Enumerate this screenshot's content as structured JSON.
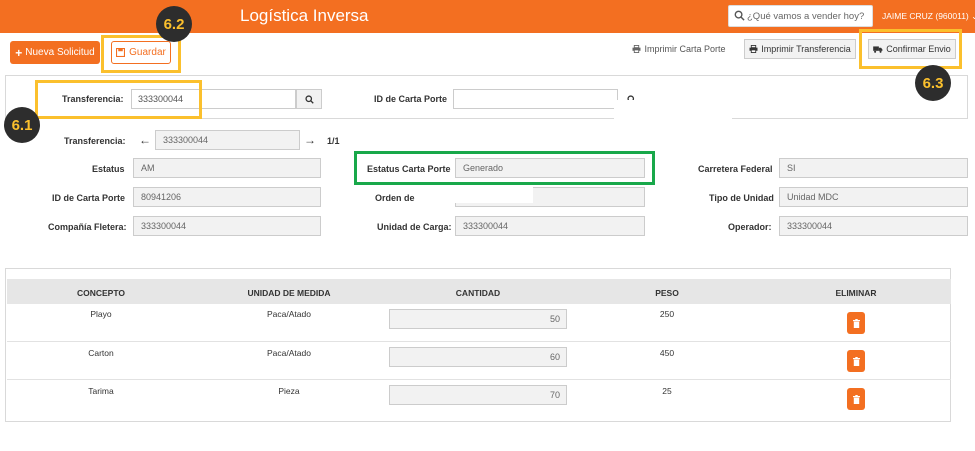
{
  "header": {
    "title": "Logística Inversa",
    "search_placeholder": "¿Qué vamos a vender hoy?",
    "user": "JAIME CRUZ (960011)",
    "user_caret": "⌄"
  },
  "toolbar": {
    "new_label": "Nueva Solicitud",
    "save_label": "Guardar",
    "print_cp_label": "Imprimir Carta Porte",
    "print_tr_label": "Imprimir Transferencia",
    "confirm_label": "Confirmar Envio"
  },
  "annotations": {
    "a61": "6.1",
    "a62": "6.2",
    "a63": "6.3"
  },
  "search_panel": {
    "transfer_label": "Transferencia:",
    "transfer_value": "333300044",
    "carta_porte_label": "ID de Carta Porte",
    "carta_porte_value": ""
  },
  "detail": {
    "transfer_label": "Transferencia:",
    "transfer_value": "333300044",
    "pager": "1/1",
    "estatus_label": "Estatus",
    "estatus_value": "AM",
    "estatus_cp_label": "Estatus Carta Porte",
    "estatus_cp_value": "Generado",
    "carretera_label": "Carretera Federal",
    "carretera_value": "SI",
    "id_cp_label": "ID de Carta Porte",
    "id_cp_value": "80941206",
    "orden_label": "Orden de",
    "orden_value": "",
    "tipo_unidad_label": "Tipo de Unidad",
    "tipo_unidad_value": "Unidad MDC",
    "compania_label": "Compañía Fletera:",
    "compania_value": "333300044",
    "unidad_carga_label": "Unidad de Carga:",
    "unidad_carga_value": "333300044",
    "operador_label": "Operador:",
    "operador_value": "333300044"
  },
  "table": {
    "headers": [
      "CONCEPTO",
      "UNIDAD DE MEDIDA",
      "CANTIDAD",
      "PESO",
      "ELIMINAR"
    ],
    "rows": [
      {
        "concepto": "Playo",
        "unidad": "Paca/Atado",
        "cantidad": "50",
        "peso": "250"
      },
      {
        "concepto": "Carton",
        "unidad": "Paca/Atado",
        "cantidad": "60",
        "peso": "450"
      },
      {
        "concepto": "Tarima",
        "unidad": "Pieza",
        "cantidad": "70",
        "peso": "25"
      }
    ]
  },
  "colors": {
    "accent": "#f36f21",
    "highlight": "#fbc02d",
    "highlight_green": "#18a84a"
  },
  "icons": {
    "search": "search-icon",
    "plus": "plus-icon",
    "save": "save-icon",
    "print": "printer-icon",
    "truck": "truck-icon",
    "arrow_left": "arrow-left-icon",
    "arrow_right": "arrow-right-icon",
    "trash": "trash-icon"
  }
}
